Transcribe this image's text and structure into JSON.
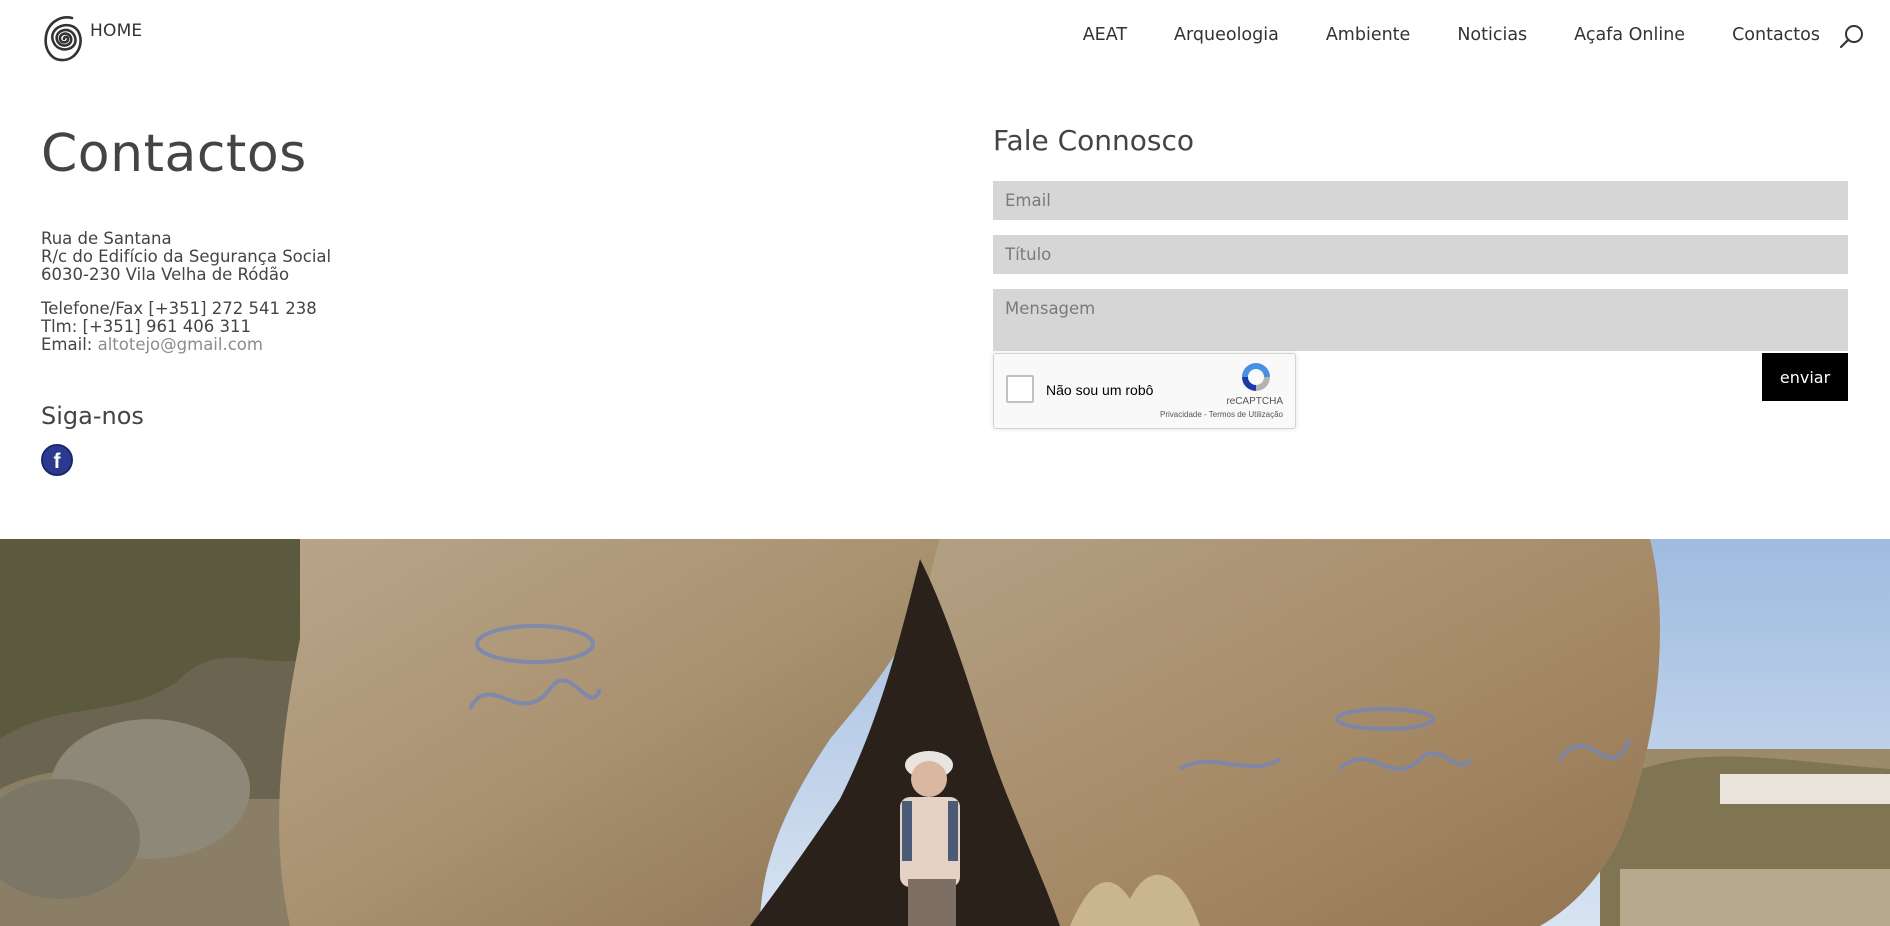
{
  "header": {
    "logo_text": "HOME",
    "nav": [
      "AEAT",
      "Arqueologia",
      "Ambiente",
      "Noticias",
      "Açafa Online",
      "Contactos"
    ]
  },
  "contact": {
    "title": "Contactos",
    "address": [
      "Rua de Santana",
      "R/c do Edifício da Segurança Social",
      "6030-230 Vila Velha de Ródão"
    ],
    "phone": "Telefone/Fax [+351] 272 541 238",
    "mobile": "Tlm: [+351] 961 406 311",
    "email_label": "Email: ",
    "email": "altotejo@gmail.com",
    "follow_title": "Siga-nos",
    "facebook_glyph": "f"
  },
  "form": {
    "title": "Fale Connosco",
    "email_placeholder": "Email",
    "title_placeholder": "Título",
    "message_placeholder": "Mensagem",
    "submit_label": "enviar",
    "recaptcha": {
      "label": "Não sou um robô",
      "brand": "reCAPTCHA",
      "terms": "Privacidade - Termos de Utilização"
    }
  },
  "icons": {
    "search": "search-icon",
    "facebook": "facebook-icon",
    "logo": "spiral-logo-icon",
    "recaptcha": "recaptcha-icon"
  },
  "colors": {
    "field_bg": "#d6d6d6",
    "button_bg": "#000000",
    "link": "#8c8c8c",
    "facebook": "#2b3a8f"
  }
}
